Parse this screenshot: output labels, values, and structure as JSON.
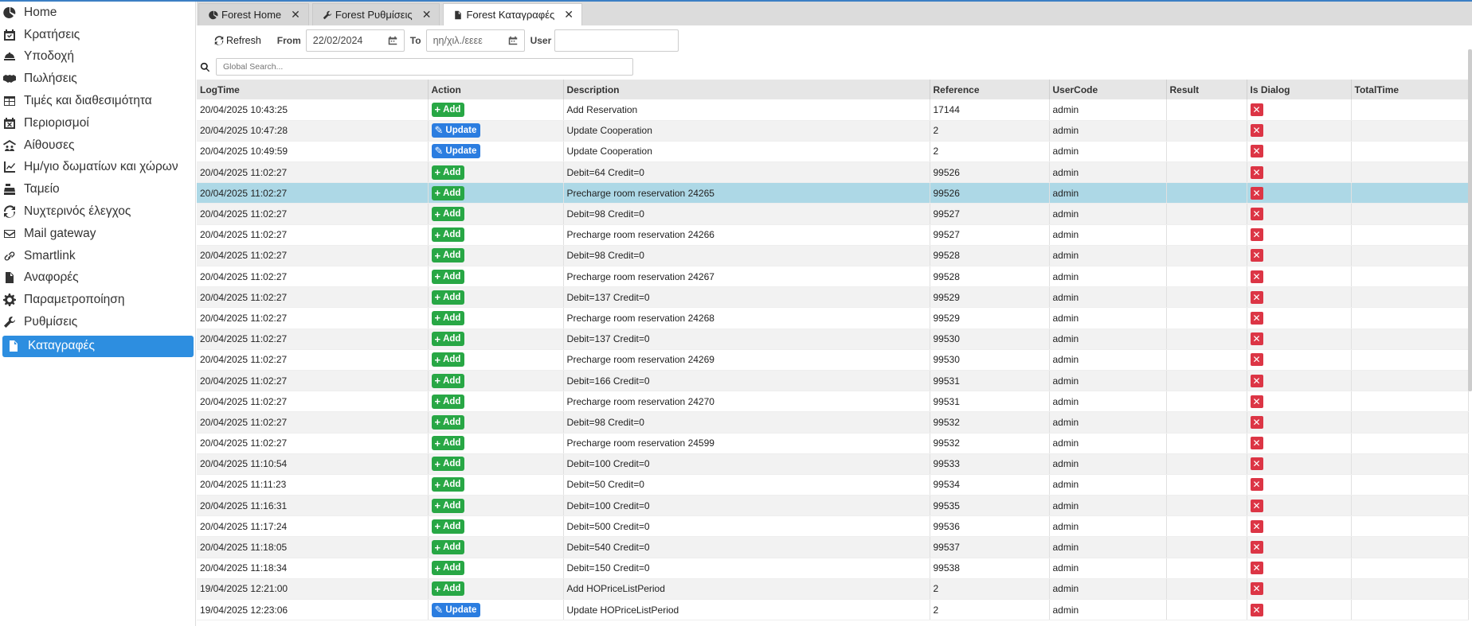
{
  "sidebar": {
    "items": [
      {
        "label": "Home",
        "icon": "chart-pie-icon"
      },
      {
        "label": "Κρατήσεις",
        "icon": "calendar-check-icon"
      },
      {
        "label": "Υποδοχή",
        "icon": "bell-concierge-icon"
      },
      {
        "label": "Πωλήσεις",
        "icon": "handshake-icon"
      },
      {
        "label": "Τιμές και διαθεσιμότητα",
        "icon": "table-icon"
      },
      {
        "label": "Περιορισμοί",
        "icon": "calendar-x-icon"
      },
      {
        "label": "Αίθουσες",
        "icon": "people-roof-icon"
      },
      {
        "label": "Ημ/γιο δωματίων και χώρων",
        "icon": "chart-line-icon"
      },
      {
        "label": "Ταμείο",
        "icon": "cash-register-icon"
      },
      {
        "label": "Νυχτερινός έλεγχος",
        "icon": "rotate-icon"
      },
      {
        "label": "Mail gateway",
        "icon": "envelope-icon"
      },
      {
        "label": "Smartlink",
        "icon": "link-icon"
      },
      {
        "label": "Αναφορές",
        "icon": "file-icon"
      },
      {
        "label": "Παραμετροποίηση",
        "icon": "gear-icon"
      },
      {
        "label": "Ρυθμίσεις",
        "icon": "wrench-icon"
      },
      {
        "label": "Καταγραφές",
        "icon": "file-icon",
        "active": true
      }
    ]
  },
  "tabs": [
    {
      "label": "Forest Home",
      "icon": "chart-pie-icon"
    },
    {
      "label": "Forest Ρυθμίσεις",
      "icon": "wrench-icon"
    },
    {
      "label": "Forest Καταγραφές",
      "icon": "file-icon",
      "active": true
    }
  ],
  "toolbar": {
    "refresh_label": "Refresh",
    "from_label": "From",
    "from_value": "22/02/2024",
    "to_label": "To",
    "to_placeholder": "ηη/χιλ./εεεε",
    "user_label": "User",
    "user_value": ""
  },
  "search": {
    "placeholder": "Global Search..."
  },
  "grid": {
    "columns": [
      "LogTime",
      "Action",
      "Description",
      "Reference",
      "UserCode",
      "Result",
      "Is Dialog",
      "TotalTime"
    ],
    "rows": [
      {
        "logtime": "20/04/2025 10:43:25",
        "action": "Add",
        "description": "Add Reservation",
        "reference": "17144",
        "usercode": "admin"
      },
      {
        "logtime": "20/04/2025 10:47:28",
        "action": "Update",
        "description": "Update Cooperation",
        "reference": "2",
        "usercode": "admin"
      },
      {
        "logtime": "20/04/2025 10:49:59",
        "action": "Update",
        "description": "Update Cooperation",
        "reference": "2",
        "usercode": "admin"
      },
      {
        "logtime": "20/04/2025 11:02:27",
        "action": "Add",
        "description": "Debit=64 Credit=0",
        "reference": "99526",
        "usercode": "admin"
      },
      {
        "logtime": "20/04/2025 11:02:27",
        "action": "Add",
        "description": "Precharge room reservation 24265",
        "reference": "99526",
        "usercode": "admin",
        "selected": true
      },
      {
        "logtime": "20/04/2025 11:02:27",
        "action": "Add",
        "description": "Debit=98 Credit=0",
        "reference": "99527",
        "usercode": "admin"
      },
      {
        "logtime": "20/04/2025 11:02:27",
        "action": "Add",
        "description": "Precharge room reservation 24266",
        "reference": "99527",
        "usercode": "admin"
      },
      {
        "logtime": "20/04/2025 11:02:27",
        "action": "Add",
        "description": "Debit=98 Credit=0",
        "reference": "99528",
        "usercode": "admin"
      },
      {
        "logtime": "20/04/2025 11:02:27",
        "action": "Add",
        "description": "Precharge room reservation 24267",
        "reference": "99528",
        "usercode": "admin"
      },
      {
        "logtime": "20/04/2025 11:02:27",
        "action": "Add",
        "description": "Debit=137 Credit=0",
        "reference": "99529",
        "usercode": "admin"
      },
      {
        "logtime": "20/04/2025 11:02:27",
        "action": "Add",
        "description": "Precharge room reservation 24268",
        "reference": "99529",
        "usercode": "admin"
      },
      {
        "logtime": "20/04/2025 11:02:27",
        "action": "Add",
        "description": "Debit=137 Credit=0",
        "reference": "99530",
        "usercode": "admin"
      },
      {
        "logtime": "20/04/2025 11:02:27",
        "action": "Add",
        "description": "Precharge room reservation 24269",
        "reference": "99530",
        "usercode": "admin"
      },
      {
        "logtime": "20/04/2025 11:02:27",
        "action": "Add",
        "description": "Debit=166 Credit=0",
        "reference": "99531",
        "usercode": "admin"
      },
      {
        "logtime": "20/04/2025 11:02:27",
        "action": "Add",
        "description": "Precharge room reservation 24270",
        "reference": "99531",
        "usercode": "admin"
      },
      {
        "logtime": "20/04/2025 11:02:27",
        "action": "Add",
        "description": "Debit=98 Credit=0",
        "reference": "99532",
        "usercode": "admin"
      },
      {
        "logtime": "20/04/2025 11:02:27",
        "action": "Add",
        "description": "Precharge room reservation 24599",
        "reference": "99532",
        "usercode": "admin"
      },
      {
        "logtime": "20/04/2025 11:10:54",
        "action": "Add",
        "description": "Debit=100 Credit=0",
        "reference": "99533",
        "usercode": "admin"
      },
      {
        "logtime": "20/04/2025 11:11:23",
        "action": "Add",
        "description": "Debit=50 Credit=0",
        "reference": "99534",
        "usercode": "admin"
      },
      {
        "logtime": "20/04/2025 11:16:31",
        "action": "Add",
        "description": "Debit=100 Credit=0",
        "reference": "99535",
        "usercode": "admin"
      },
      {
        "logtime": "20/04/2025 11:17:24",
        "action": "Add",
        "description": "Debit=500 Credit=0",
        "reference": "99536",
        "usercode": "admin"
      },
      {
        "logtime": "20/04/2025 11:18:05",
        "action": "Add",
        "description": "Debit=540 Credit=0",
        "reference": "99537",
        "usercode": "admin"
      },
      {
        "logtime": "20/04/2025 11:18:34",
        "action": "Add",
        "description": "Debit=150 Credit=0",
        "reference": "99538",
        "usercode": "admin"
      },
      {
        "logtime": "19/04/2025 12:21:00",
        "action": "Add",
        "description": "Add HOPriceListPeriod",
        "reference": "2",
        "usercode": "admin"
      },
      {
        "logtime": "19/04/2025 12:23:06",
        "action": "Update",
        "description": "Update HOPriceListPeriod",
        "reference": "2",
        "usercode": "admin"
      }
    ]
  },
  "colors": {
    "accent": "#2d8ee0",
    "add": "#28a745",
    "update": "#2b7de0",
    "dialog_no": "#dc3545",
    "selected_row": "#add8e6"
  }
}
